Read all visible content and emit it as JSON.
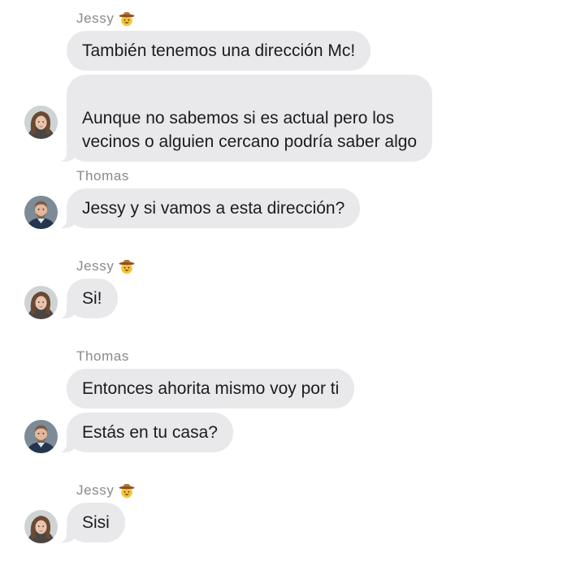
{
  "messages": [
    {
      "sender": "Jessy",
      "sender_emoji": "cowboy-emoji",
      "bubbles": [
        "También tenemos una dirección Mc!",
        "Aunque no sabemos si es actual pero los\nvecinos o alguien cercano podría saber algo"
      ],
      "avatar": "jessy-avatar"
    },
    {
      "sender": "Thomas",
      "bubbles": [
        "Jessy y si vamos a esta dirección?"
      ],
      "avatar": "thomas-avatar"
    },
    {
      "sender": "Jessy",
      "sender_emoji": "cowboy-emoji",
      "bubbles": [
        "Si!"
      ],
      "avatar": "jessy-avatar"
    },
    {
      "sender": "Thomas",
      "bubbles": [
        "Entonces ahorita mismo voy por ti",
        "Estás en tu casa?"
      ],
      "avatar": "thomas-avatar"
    },
    {
      "sender": "Jessy",
      "sender_emoji": "cowboy-emoji",
      "bubbles": [
        "Sisi"
      ],
      "avatar": "jessy-avatar"
    }
  ],
  "colors": {
    "bubble_bg": "#e9e9eb",
    "text": "#1c1c1e",
    "sender_name": "#8a8a8e",
    "background": "#ffffff"
  }
}
